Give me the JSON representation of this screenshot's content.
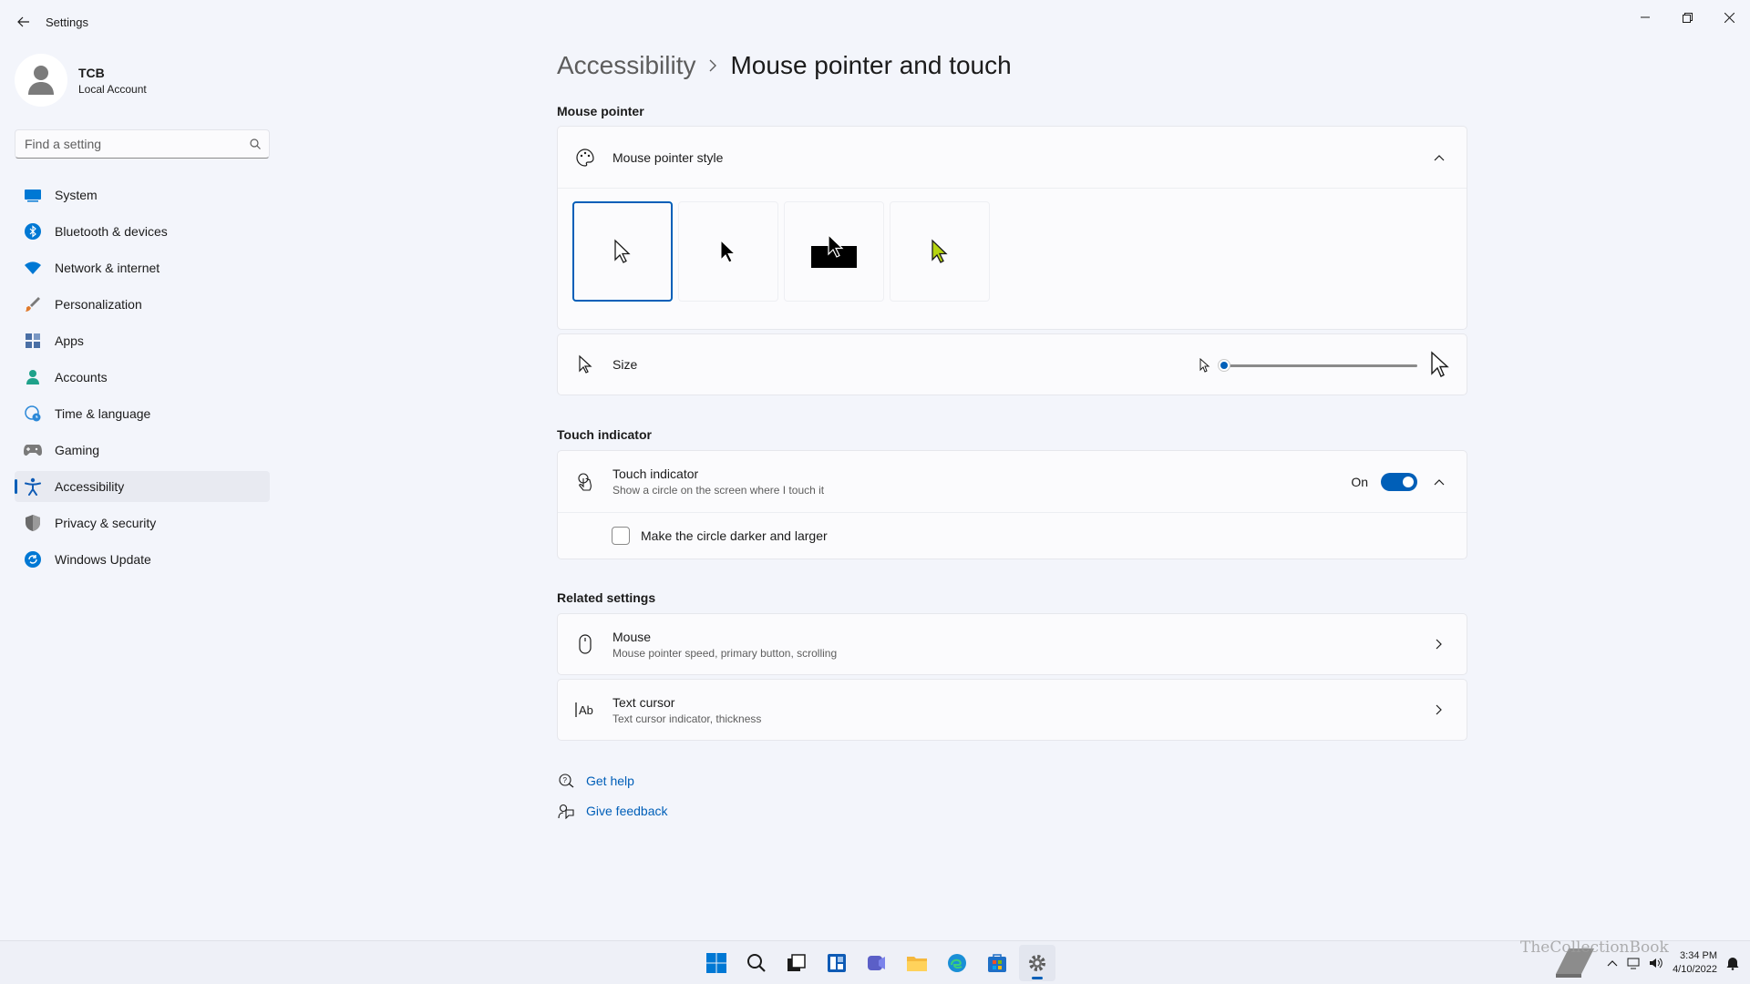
{
  "window": {
    "app_title": "Settings"
  },
  "profile": {
    "name": "TCB",
    "account_type": "Local Account"
  },
  "search": {
    "placeholder": "Find a setting"
  },
  "sidebar": {
    "items": [
      {
        "label": "System",
        "icon": "monitor-icon",
        "color": "#0078d4"
      },
      {
        "label": "Bluetooth & devices",
        "icon": "bluetooth-icon",
        "color": "#0078d4"
      },
      {
        "label": "Network & internet",
        "icon": "wifi-icon",
        "color": "#0078d4"
      },
      {
        "label": "Personalization",
        "icon": "brush-icon",
        "color": "#e07a2c"
      },
      {
        "label": "Apps",
        "icon": "apps-icon",
        "color": "#4a6fa5"
      },
      {
        "label": "Accounts",
        "icon": "person-icon",
        "color": "#1fa18a"
      },
      {
        "label": "Time & language",
        "icon": "globe-clock-icon",
        "color": "#2b88d8"
      },
      {
        "label": "Gaming",
        "icon": "gamepad-icon",
        "color": "#7a7a7a"
      },
      {
        "label": "Accessibility",
        "icon": "accessibility-icon",
        "color": "#0f5bb5",
        "active": true
      },
      {
        "label": "Privacy & security",
        "icon": "shield-icon",
        "color": "#6b6b6b"
      },
      {
        "label": "Windows Update",
        "icon": "update-icon",
        "color": "#0078d4"
      }
    ]
  },
  "breadcrumb": {
    "parent": "Accessibility",
    "current": "Mouse pointer and touch"
  },
  "mouse_pointer": {
    "section_label": "Mouse pointer",
    "style_title": "Mouse pointer style",
    "style_options": [
      "white",
      "black",
      "inverted",
      "custom"
    ],
    "selected_style": "white",
    "custom_color": "#b5d40f",
    "size_title": "Size",
    "size_value_fraction": 0.0
  },
  "touch_indicator": {
    "section_label": "Touch indicator",
    "title": "Touch indicator",
    "subtitle": "Show a circle on the screen where I touch it",
    "toggle_label": "On",
    "toggle_on": true,
    "checkbox_label": "Make the circle darker and larger",
    "checkbox_checked": false
  },
  "related": {
    "section_label": "Related settings",
    "items": [
      {
        "title": "Mouse",
        "subtitle": "Mouse pointer speed, primary button, scrolling",
        "icon": "mouse-icon"
      },
      {
        "title": "Text cursor",
        "subtitle": "Text cursor indicator, thickness",
        "icon": "text-cursor-icon"
      }
    ]
  },
  "help": {
    "get_help": "Get help",
    "give_feedback": "Give feedback"
  },
  "taskbar": {
    "clock_time": "3:34 PM",
    "clock_date": "4/10/2022"
  },
  "watermark": "TheCollectionBook",
  "colors": {
    "accent": "#005fb8"
  }
}
